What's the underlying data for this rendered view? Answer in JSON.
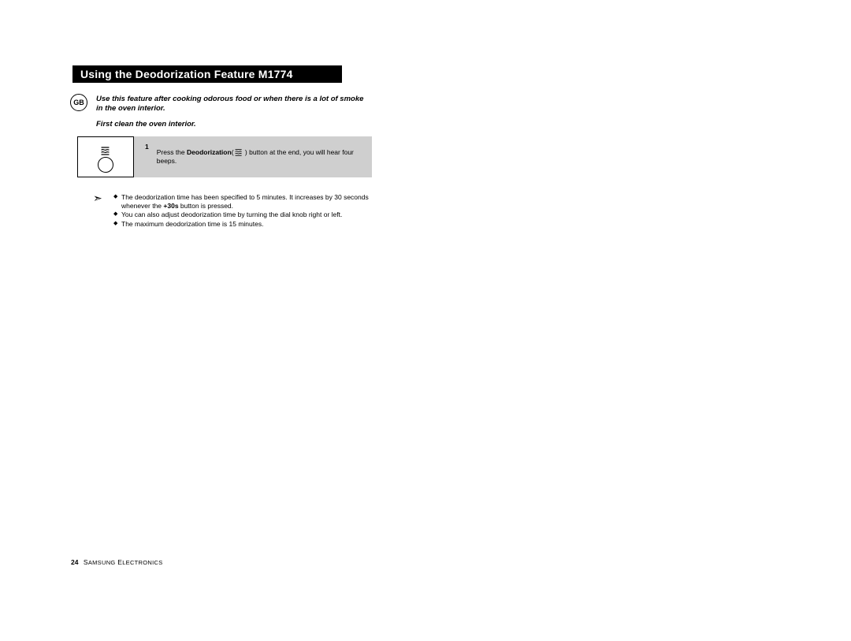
{
  "title": "Using the Deodorization Feature M1774",
  "badge": "GB",
  "intro_line1": "Use this feature after cooking odorous food or when there is a lot of smoke in the oven interior.",
  "intro_line2": "First clean the oven interior.",
  "step": {
    "number": "1",
    "before_bold": "Press the ",
    "bold_word": "Deodorization",
    "paren_open": "(",
    "paren_close": " )",
    "after": " button at the end, you will hear four beeps."
  },
  "notes": {
    "b1_before": "The deodorization time has been specified to 5 minutes. It increases by 30 seconds whenever the ",
    "b1_bold": "+30s",
    "b1_after": " button is pressed.",
    "b2": "You can also adjust  deodorization time by turning the dial knob right or left.",
    "b3": "The maximum deodorization time is 15 minutes."
  },
  "footer": {
    "page": "24",
    "brand_a": "S",
    "brand_b": "AMSUNG",
    "brand_c": " E",
    "brand_d": "LECTRONICS"
  }
}
